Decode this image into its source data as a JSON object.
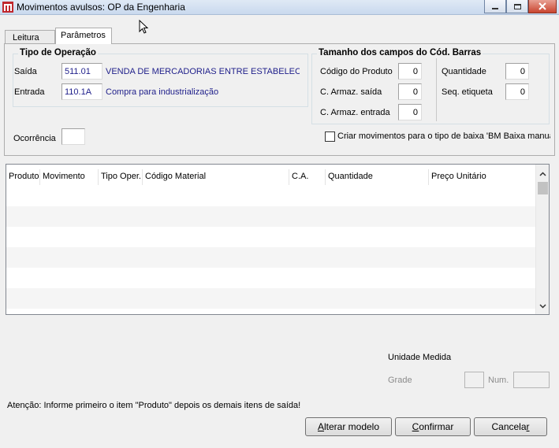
{
  "window": {
    "title": "Movimentos avulsos: OP da Engenharia",
    "minimize_label": "minimize",
    "maximize_label": "maximize",
    "close_label": "close"
  },
  "tabs": [
    {
      "label": "Leitura",
      "active": false
    },
    {
      "label": "Parâmetros",
      "active": true
    }
  ],
  "tipo_operacao": {
    "title": "Tipo de Operação",
    "saida_label": "Saída",
    "saida_code": "511.01",
    "saida_desc": "VENDA DE MERCADORIAS ENTRE ESTABELECIMENTOS",
    "entrada_label": "Entrada",
    "entrada_code": "110.1A",
    "entrada_desc": "Compra para industrialização"
  },
  "tamanho_campos": {
    "title": "Tamanho dos campos do Cód. Barras",
    "codigo_produto_label": "Código do Produto",
    "codigo_produto_value": "0",
    "armaz_saida_label": "C. Armaz. saída",
    "armaz_saida_value": "0",
    "armaz_entrada_label": "C. Armaz. entrada",
    "armaz_entrada_value": "0",
    "quantidade_label": "Quantidade",
    "quantidade_value": "0",
    "seq_etiqueta_label": "Seq. etiqueta",
    "seq_etiqueta_value": "0"
  },
  "ocorrencia": {
    "label": "Ocorrência",
    "value": ""
  },
  "criar_movimentos": {
    "label": "Criar movimentos para o tipo de baixa 'BM Baixa manual",
    "checked": false
  },
  "grid": {
    "columns": [
      "Produto",
      "Movimento",
      "Tipo Oper.",
      "Código Material",
      "C.A.",
      "Quantidade",
      "Preço Unitário"
    ],
    "rows": []
  },
  "unidade_medida": {
    "title": "Unidade Medida",
    "grade_label": "Grade",
    "num_label": "Num."
  },
  "status_text": "Atenção: Informe primeiro o item \"Produto\" depois os demais itens de saída!",
  "buttons": {
    "alterar_prefix": "",
    "alterar_mnemonic": "A",
    "alterar_rest": "lterar modelo",
    "confirmar_prefix": "",
    "confirmar_mnemonic": "C",
    "confirmar_rest": "onfirmar",
    "cancelar_prefix": "Cancela",
    "cancelar_mnemonic": "r",
    "cancelar_rest": ""
  },
  "colors": {
    "accent_text": "#1e1e8a",
    "close_button": "#c9452f"
  }
}
